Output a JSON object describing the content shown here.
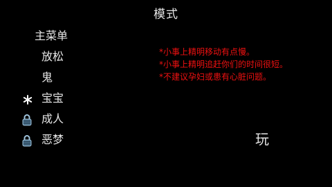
{
  "title": "模式",
  "menu": {
    "main_menu": "主菜单",
    "modes": [
      {
        "label": "放松",
        "state": "unlocked"
      },
      {
        "label": "鬼",
        "state": "unlocked"
      },
      {
        "label": "宝宝",
        "state": "selected",
        "icon": "star-icon"
      },
      {
        "label": "成人",
        "state": "locked",
        "icon": "lock-icon"
      },
      {
        "label": "恶梦",
        "state": "locked",
        "icon": "lock-icon"
      }
    ]
  },
  "warnings": [
    "*小事上精明移动有点慢。",
    "*小事上精明追赶你们的时间很短。",
    "*不建议孕妇或患有心脏问题。"
  ],
  "play_label": "玩",
  "colors": {
    "background": "#000000",
    "text": "#e6e6e6",
    "warning": "#ee1111",
    "lock_fill": "#4a6f8a",
    "lock_highlight": "#9fc3dc"
  }
}
